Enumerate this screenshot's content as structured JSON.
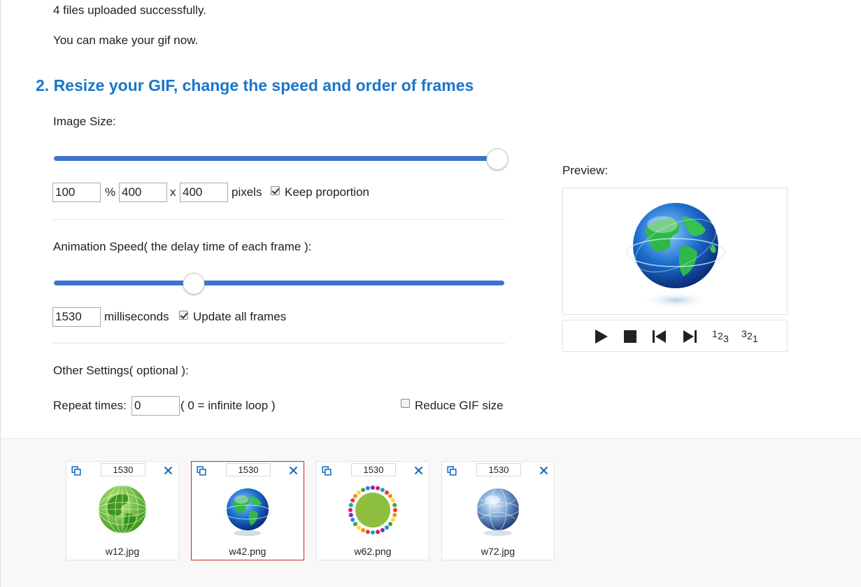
{
  "upload_status": {
    "line1": "4 files uploaded successfully.",
    "line2": "You can make your gif now."
  },
  "section": {
    "title": "2. Resize your GIF, change the speed and order of frames"
  },
  "image_size": {
    "label": "Image Size:",
    "slider_fraction": 0.984,
    "percent_value": "100",
    "percent_sign": "%",
    "width_value": "400",
    "x_sep": "x",
    "height_value": "400",
    "pixels_label": "pixels",
    "keep_proportion_label": "Keep proportion",
    "keep_proportion_checked": true
  },
  "animation_speed": {
    "label": "Animation Speed( the delay time of each frame ):",
    "slider_fraction": 0.31,
    "delay_value": "1530",
    "ms_label": "milliseconds",
    "update_all_label": "Update all frames",
    "update_all_checked": true
  },
  "other_settings": {
    "label": "Other Settings( optional ):",
    "repeat_label": "Repeat times:",
    "repeat_value": "0",
    "repeat_hint": "( 0 = infinite loop )",
    "reduce_label": "Reduce GIF size",
    "reduce_checked": false
  },
  "preview": {
    "label": "Preview:",
    "controls": {
      "play": "play-icon",
      "stop": "stop-icon",
      "prev": "previous-frame-icon",
      "next": "next-frame-icon",
      "order_forward": "123",
      "order_reverse": "321"
    }
  },
  "frames": [
    {
      "delay": "1530",
      "filename": "w12.jpg",
      "selected": false,
      "icon": "green-wireframe-globe"
    },
    {
      "delay": "1530",
      "filename": "w42.png",
      "selected": true,
      "icon": "blue-green-globe"
    },
    {
      "delay": "1530",
      "filename": "w62.png",
      "selected": false,
      "icon": "people-ring-globe"
    },
    {
      "delay": "1530",
      "filename": "w72.jpg",
      "selected": false,
      "icon": "glass-globe"
    }
  ],
  "colors": {
    "title_blue": "#1a76c9",
    "slider_blue": "#3c73cf",
    "selected_frame_border": "#c9262b",
    "icon_blue": "#1a6fc4"
  }
}
